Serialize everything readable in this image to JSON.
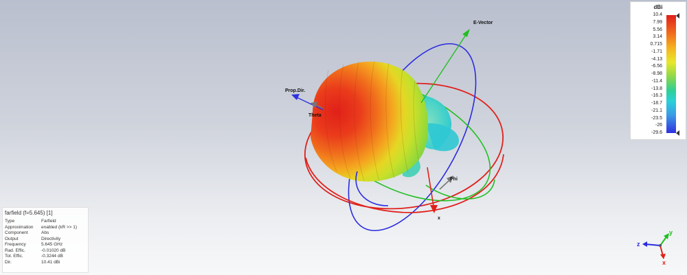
{
  "scene": {
    "labels": {
      "e_vector": "E-Vector",
      "prop_dir": "Prop.Dir.",
      "theta": "Theta",
      "phi": "Phi",
      "x_axis": "x"
    },
    "colors": {
      "ring_red": "#e0201a",
      "ring_green": "#1fbf1f",
      "ring_blue": "#2a2ae0",
      "e_vector_arrow": "#1fbf1f",
      "prop_dir_arrow": "#3030e0",
      "x_arrow": "#e0201a",
      "phi_arrow": "#777777"
    }
  },
  "legend": {
    "unit": "dBi",
    "ticks": [
      "10.4",
      "7.99",
      "5.56",
      "3.14",
      "0.715",
      "-1.71",
      "-4.13",
      "-6.56",
      "-8.98",
      "-11.4",
      "-13.8",
      "-16.3",
      "-18.7",
      "-21.1",
      "-23.5",
      "-26",
      "-29.6"
    ],
    "max_value": 10.4,
    "min_value": -29.6
  },
  "info": {
    "title": "farfield (f=5.645) [1]",
    "rows": [
      {
        "key": "Type",
        "value": "Farfield"
      },
      {
        "key": "Approximation",
        "value": "enabled (kR >> 1)"
      },
      {
        "key": "Component",
        "value": "Abs"
      },
      {
        "key": "Output",
        "value": "Directivity"
      },
      {
        "key": "Frequency",
        "value": "5.645 GHz"
      },
      {
        "key": "Rad. Effic.",
        "value": "-0.01020 dB"
      },
      {
        "key": "Tot. Effic.",
        "value": "-0.3244 dB"
      },
      {
        "key": "Dir.",
        "value": "10.41 dBi"
      }
    ]
  },
  "triad": {
    "z_label": "z",
    "y_label": "y",
    "x_label": "x"
  }
}
